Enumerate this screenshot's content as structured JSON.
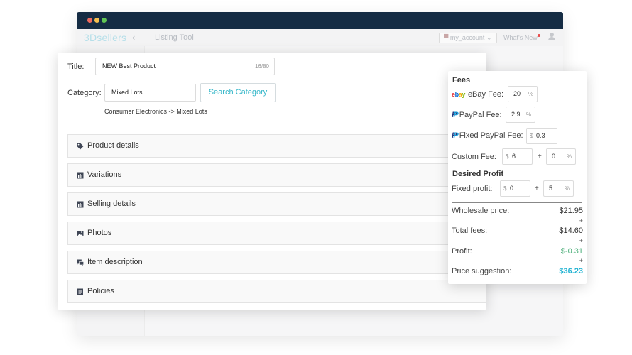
{
  "app": {
    "logo": "3Dsellers",
    "back_glyph": "‹",
    "section_title": "Listing Tool",
    "account_flag": "▀",
    "account_label": "my_account",
    "account_caret": "⌄",
    "whats_new": "What's New"
  },
  "listing": {
    "title_label": "Title:",
    "title_value": "NEW Best Product",
    "title_counter": "16/80",
    "category_label": "Category:",
    "category_value": "Mixed Lots",
    "search_button": "Search Category",
    "category_path": "Consumer Electronics -> Mixed Lots",
    "sections": [
      {
        "label": "Product details",
        "icon": "tag-icon"
      },
      {
        "label": "Variations",
        "icon": "bar-chart-icon"
      },
      {
        "label": "Selling details",
        "icon": "bar-chart-icon"
      },
      {
        "label": "Photos",
        "icon": "image-icon"
      },
      {
        "label": "Item description",
        "icon": "chat-icon"
      },
      {
        "label": "Policies",
        "icon": "document-icon"
      }
    ]
  },
  "fees": {
    "heading": "Fees",
    "ebay_label": "eBay Fee:",
    "ebay_value": "20",
    "paypal_label": "PayPal Fee:",
    "paypal_value": "2.9",
    "fixed_paypal_label": "Fixed PayPal Fee:",
    "fixed_paypal_value": "0.3",
    "custom_label": "Custom Fee:",
    "custom_fixed": "6",
    "custom_percent": "0",
    "desired_heading": "Desired Profit",
    "fixed_profit_label": "Fixed profit:",
    "profit_fixed": "0",
    "profit_percent": "5",
    "currency_symbol": "$",
    "percent_symbol": "%",
    "plus_symbol": "+",
    "summary": {
      "wholesale_label": "Wholesale price:",
      "wholesale_value": "$21.95",
      "total_fees_label": "Total fees:",
      "total_fees_value": "$14.60",
      "profit_label": "Profit:",
      "profit_value": "$-0.31",
      "suggestion_label": "Price suggestion:",
      "suggestion_value": "$36.23"
    }
  },
  "colors": {
    "titlebar": "#152c44",
    "accent": "#35b7c9",
    "profit": "#4caf7a",
    "suggestion": "#22b3d2"
  }
}
